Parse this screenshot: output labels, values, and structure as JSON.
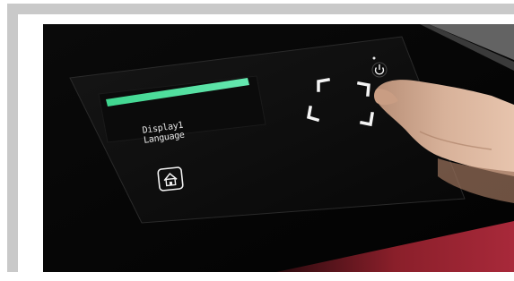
{
  "panel": {
    "display_line1": "Display1",
    "display_line2": "Language"
  },
  "colors": {
    "status_bar": "#4fe0a0",
    "accent_red": "#8a1f2a",
    "icon_white": "#f2f2f2"
  },
  "icons": {
    "home": "home-icon",
    "power": "power-icon",
    "scan_frame": "scan-corners-icon"
  }
}
